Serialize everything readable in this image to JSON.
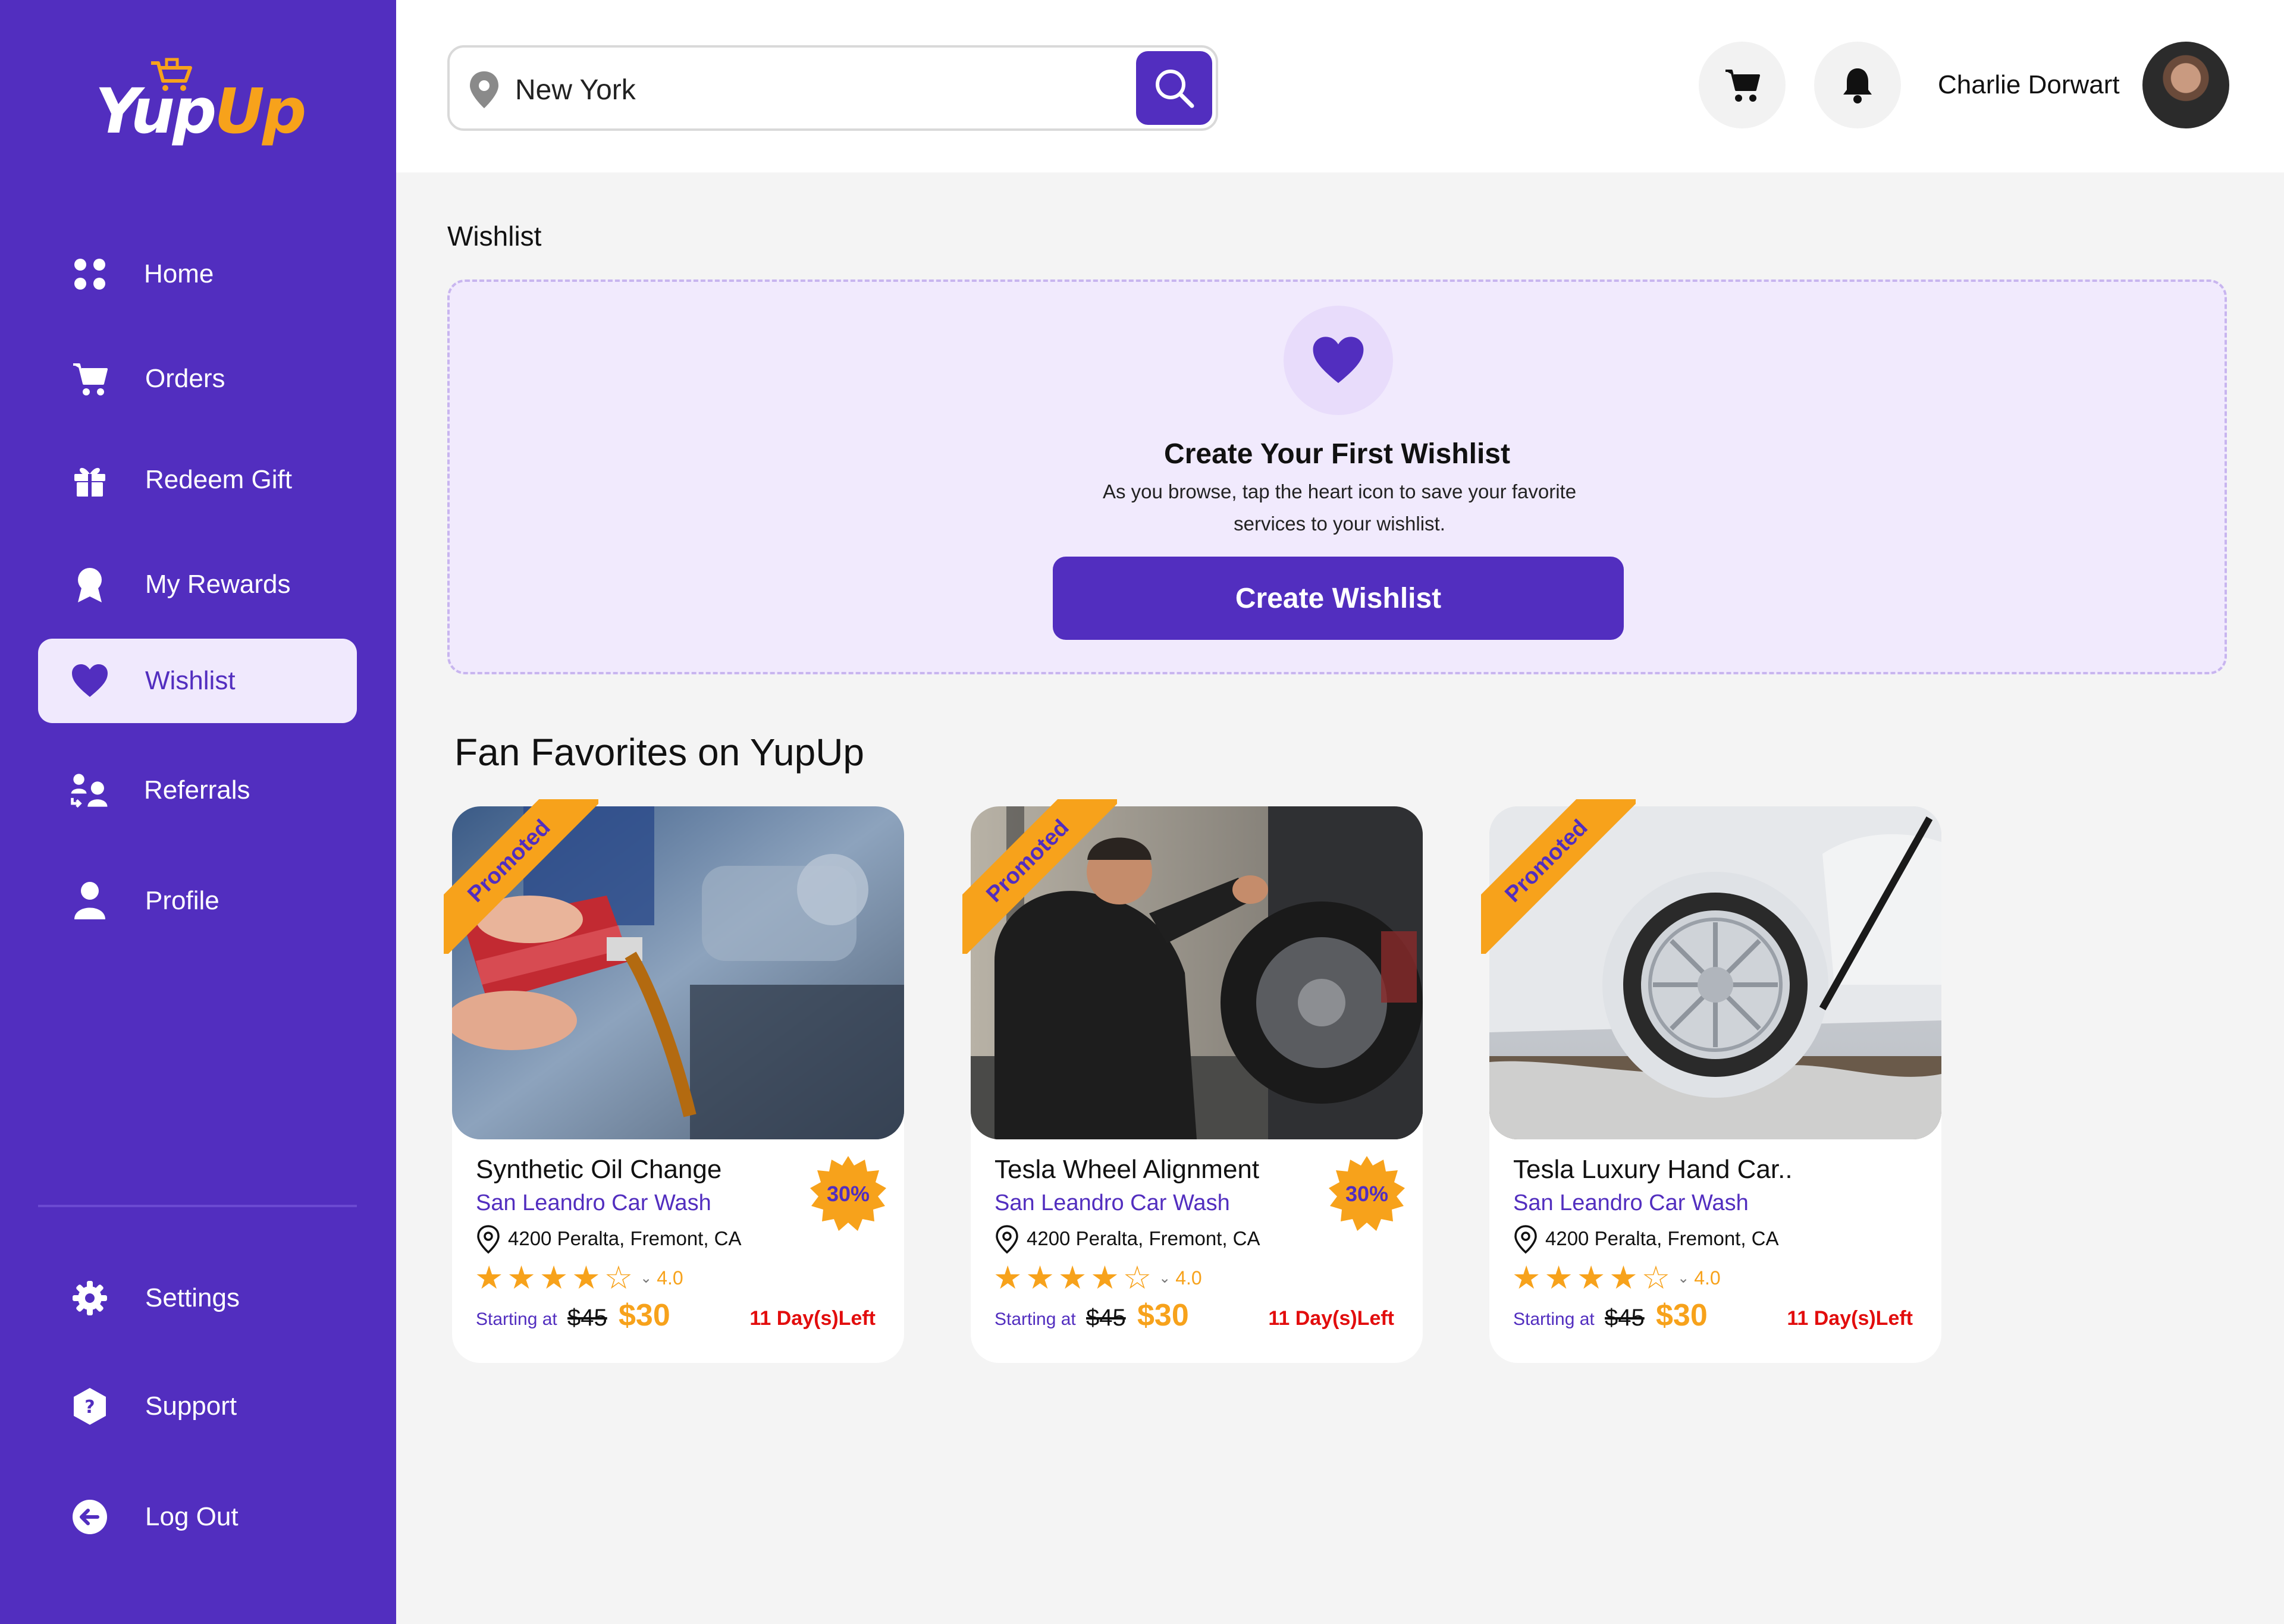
{
  "brand": {
    "yup": "Yup",
    "up": "Up"
  },
  "colors": {
    "primary": "#522ebf",
    "accent": "#f7a21b",
    "danger": "#e20d0d",
    "light": "#f0e9fd"
  },
  "sidebar": {
    "items": [
      {
        "label": "Home",
        "icon": "home-grid-icon"
      },
      {
        "label": "Orders",
        "icon": "cart-icon"
      },
      {
        "label": "Redeem Gift",
        "icon": "gift-icon"
      },
      {
        "label": "My Rewards",
        "icon": "award-icon"
      },
      {
        "label": "Wishlist",
        "icon": "heart-icon",
        "active": true
      },
      {
        "label": "Referrals",
        "icon": "referral-icon"
      },
      {
        "label": "Profile",
        "icon": "user-icon"
      }
    ],
    "bottom_items": [
      {
        "label": "Settings",
        "icon": "gear-icon"
      },
      {
        "label": "Support",
        "icon": "help-icon"
      },
      {
        "label": "Log Out",
        "icon": "logout-icon"
      }
    ]
  },
  "header": {
    "search_value": "New York",
    "user_name": "Charlie Dorwart"
  },
  "main": {
    "page_title": "Wishlist",
    "empty_state": {
      "title": "Create Your First Wishlist",
      "text": "As you browse, tap the heart icon to save your favorite services to your wishlist.",
      "button": "Create Wishlist"
    },
    "section_title": "Fan Favorites on YupUp",
    "cards": [
      {
        "ribbon": "Promoted",
        "title": "Synthetic Oil Change",
        "vendor": "San Leandro Car Wash",
        "address": "4200 Peralta, Fremont, CA",
        "rating": "4.0",
        "stars": 4,
        "starting": "Starting at",
        "old_price": "$45",
        "new_price": "$30",
        "days_left": "11 Day(s)Left",
        "discount": "30%"
      },
      {
        "ribbon": "Promoted",
        "title": "Tesla Wheel Alignment",
        "vendor": "San Leandro Car Wash",
        "address": "4200 Peralta, Fremont, CA",
        "rating": "4.0",
        "stars": 4,
        "starting": "Starting at",
        "old_price": "$45",
        "new_price": "$30",
        "days_left": "11 Day(s)Left",
        "discount": "30%"
      },
      {
        "ribbon": "Promoted",
        "title": "Tesla Luxury Hand Car..",
        "vendor": "San Leandro Car Wash",
        "address": "4200 Peralta, Fremont, CA",
        "rating": "4.0",
        "stars": 4,
        "starting": "Starting at",
        "old_price": "$45",
        "new_price": "$30",
        "days_left": "11 Day(s)Left",
        "discount": ""
      }
    ]
  }
}
